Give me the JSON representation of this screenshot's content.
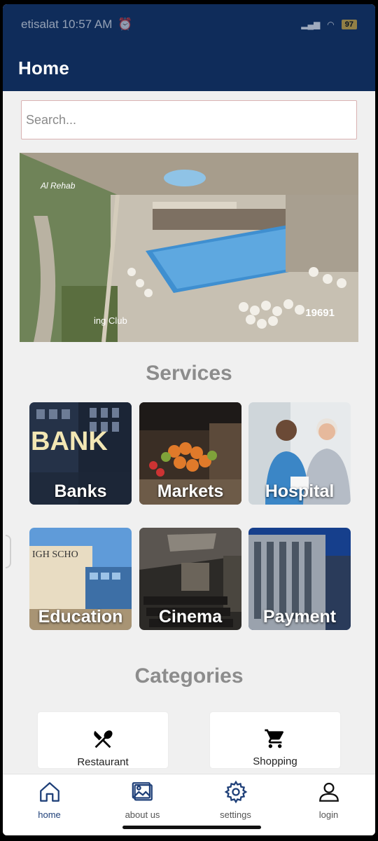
{
  "status_bar": {
    "carrier_time": "etisalat 10:57 AM",
    "battery": "97"
  },
  "app_bar": {
    "title": "Home"
  },
  "search": {
    "placeholder": "Search..."
  },
  "banner": {
    "caption": "ing Club",
    "number": "19691",
    "logo_text": "Al Rehab"
  },
  "services": {
    "title": "Services",
    "items": [
      {
        "label": "Banks"
      },
      {
        "label": "Markets"
      },
      {
        "label": "Hospital"
      },
      {
        "label": "Education"
      },
      {
        "label": "Cinema"
      },
      {
        "label": "Payment"
      }
    ]
  },
  "categories": {
    "title": "Categories",
    "items": [
      {
        "label": "Restaurant",
        "icon": "restaurant-icon"
      },
      {
        "label": "Shopping",
        "icon": "cart-icon"
      }
    ]
  },
  "bottom_nav": {
    "items": [
      {
        "label": "home",
        "icon": "home-icon",
        "active": true
      },
      {
        "label": "about us",
        "icon": "image-icon",
        "active": false
      },
      {
        "label": "settings",
        "icon": "gear-icon",
        "active": false
      },
      {
        "label": "login",
        "icon": "person-icon",
        "active": false
      }
    ]
  },
  "colors": {
    "primary": "#0f2c5a",
    "nav_active": "#1e3f78",
    "section_title": "#8c8c8c"
  }
}
